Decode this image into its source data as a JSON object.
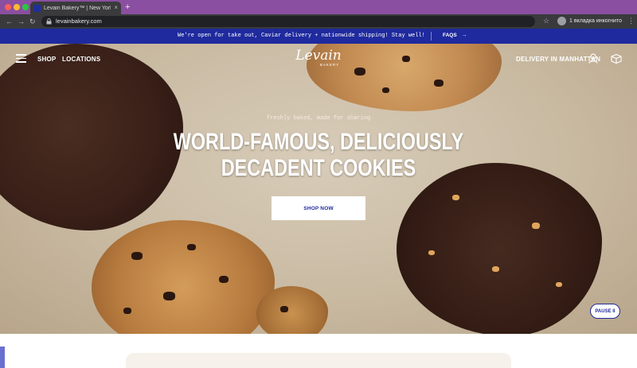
{
  "browser": {
    "tab_title": "Levain Bakery™ | New York Cit",
    "tab_close": "×",
    "new_tab": "+",
    "url": "levainbakery.com",
    "incognito_label": "1 вкладка инкогнито",
    "back": "←",
    "forward": "→",
    "reload": "↻",
    "star": "☆",
    "menu": "⋮"
  },
  "announcement": {
    "text": "We're open for take out, Caviar delivery + nationwide shipping! Stay well!",
    "faqs_label": "FAQS",
    "faqs_arrow": "→"
  },
  "header": {
    "nav": {
      "shop": "SHOP",
      "locations": "LOCATIONS"
    },
    "logo": "Levain",
    "logo_sub": "BAKERY",
    "delivery": "DELIVERY IN MANHATTAN"
  },
  "hero": {
    "tagline": "freshly baked, made for sharing",
    "headline_line1": "WORLD-FAMOUS, DELICIOUSLY",
    "headline_line2": "DECADENT COOKIES",
    "cta": "SHOP NOW",
    "pause": "PAUSE II"
  },
  "colors": {
    "brand_blue": "#1f2a9e",
    "browser_frame": "#8a4fa0"
  }
}
